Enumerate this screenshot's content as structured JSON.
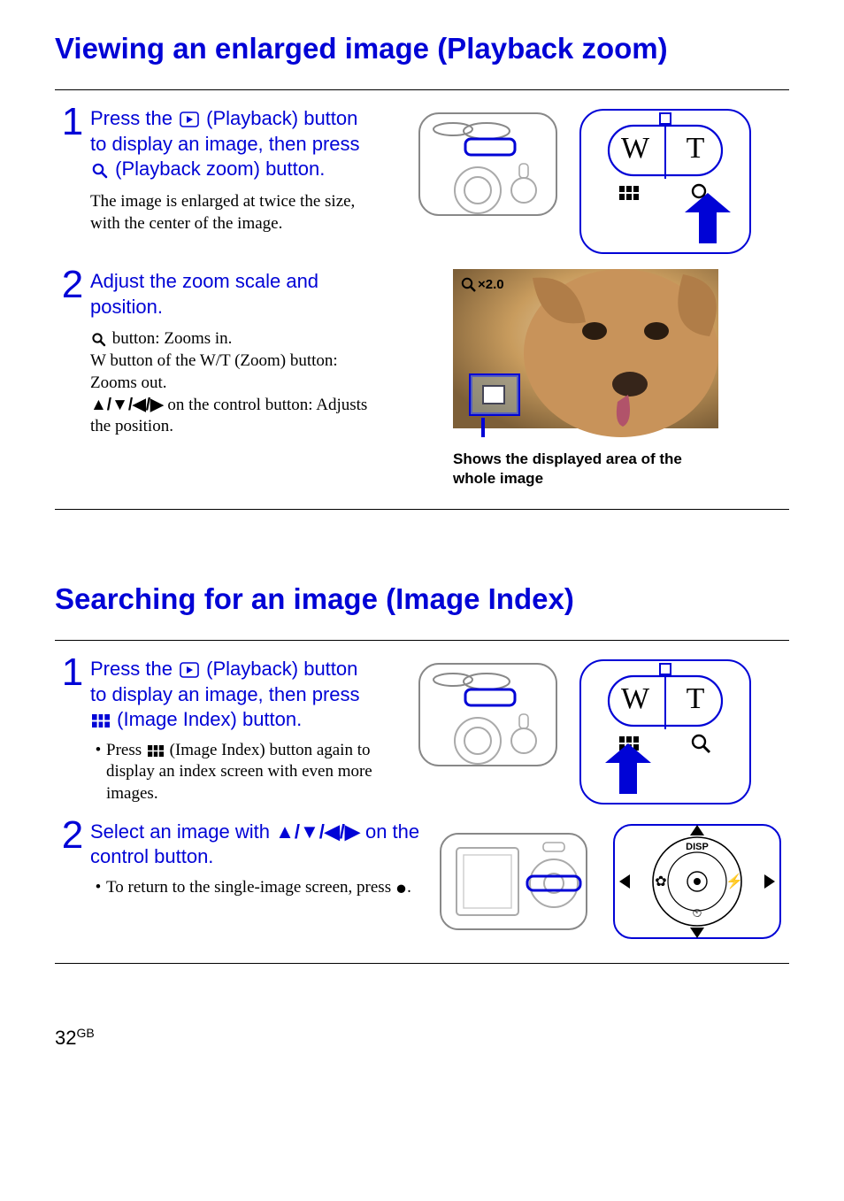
{
  "section1": {
    "title": "Viewing an enlarged image (Playback zoom)",
    "step1": {
      "num": "1",
      "prefix": "Press the ",
      "mid": " (Playback) button to display an image, then press ",
      "suffix": " (Playback zoom) button.",
      "detail": "The image is enlarged at twice the size, with the center of the image."
    },
    "step2": {
      "num": "2",
      "heading": "Adjust the zoom scale and position.",
      "line_a_suffix": " button: Zooms in.",
      "line_b": "W button of the W/T (Zoom) button: Zooms out.",
      "line_c_suffix": " on the control button: Adjusts the position.",
      "arrows": "▲/▼/◀/▶",
      "caption": "Shows the displayed area of the whole image"
    },
    "wt_W": "W",
    "wt_T": "T",
    "zoom_badge": "×2.0"
  },
  "section2": {
    "title": "Searching for an image (Image Index)",
    "step1": {
      "num": "1",
      "prefix": "Press the ",
      "mid": " (Playback) button to display an image, then press ",
      "suffix": " (Image Index) button.",
      "bullet_prefix": "Press ",
      "bullet_suffix": "  (Image Index) button again to display an index screen with even more images."
    },
    "step2": {
      "num": "2",
      "prefix": "Select an image with ",
      "arrows": "▲/▼/◀/▶",
      "suffix": " on the control button.",
      "bullet_prefix": "To return to the single-image screen, press ",
      "bullet_dot": "●",
      "bullet_suffix": "."
    },
    "wt_W": "W",
    "wt_T": "T",
    "disp_label": "DISP"
  },
  "page_number": "32",
  "page_suffix": "GB"
}
